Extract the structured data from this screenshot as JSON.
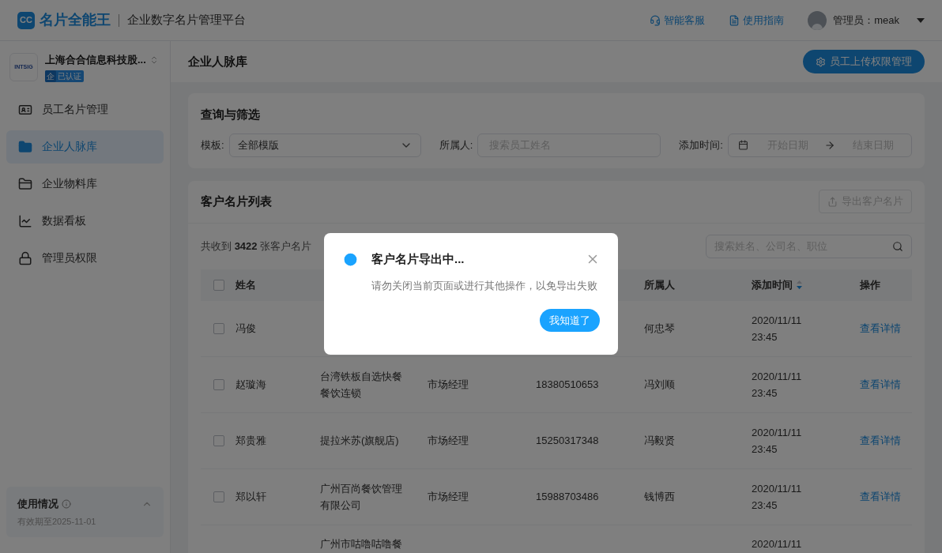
{
  "header": {
    "logo_mark": "CC",
    "brand": "名片全能王",
    "subtitle": "企业数字名片管理平台",
    "links": [
      {
        "label": "智能客服",
        "kind": "support"
      },
      {
        "label": "使用指南",
        "kind": "guide"
      }
    ],
    "user": "管理员：meak"
  },
  "company": {
    "logo_text": "INTSIG",
    "name": "上海合合信息科技股...",
    "badge_mark": "企",
    "badge": "已认证"
  },
  "sidebar": {
    "items": [
      {
        "label": "员工名片管理",
        "kind": "card",
        "selected": false
      },
      {
        "label": "企业人脉库",
        "kind": "contacts",
        "selected": true
      },
      {
        "label": "企业物料库",
        "kind": "folder",
        "selected": false
      },
      {
        "label": "数据看板",
        "kind": "chart",
        "selected": false
      },
      {
        "label": "管理员权限",
        "kind": "lock",
        "selected": false
      }
    ],
    "usage": {
      "title": "使用情况",
      "expiry": "有效期至2025-11-01",
      "expanded": true
    }
  },
  "page": {
    "title": "企业人脉库",
    "action": "员工上传权限管理"
  },
  "filter": {
    "title": "查询与筛选",
    "template_label": "模板:",
    "template_value": "全部模版",
    "owner_label": "所属人:",
    "owner_placeholder": "搜索员工姓名",
    "date_label": "添加时间:",
    "start_placeholder": "开始日期",
    "end_placeholder": "结束日期"
  },
  "list": {
    "title": "客户名片列表",
    "export": "导出客户名片",
    "export_disabled": true,
    "count_prefix": "共收到 ",
    "count": "3422",
    "count_suffix": " 张客户名片",
    "search_placeholder": "搜索姓名、公司名、职位",
    "header": {
      "checked": false,
      "name": "姓名",
      "owner": "所属人",
      "added": "添加时间",
      "added_sort_descending": true,
      "action": "操作"
    },
    "rows": [
      {
        "checked": false,
        "name": "冯俊",
        "owner": "何忠琴",
        "date": "2020/11/11",
        "time": "23:45",
        "action": "查看详情"
      },
      {
        "checked": false,
        "name": "赵璇海",
        "company": "台湾铁板自选快餐餐饮连锁",
        "position": "市场经理",
        "phone": "18380510653",
        "owner": "冯刘顺",
        "date": "2020/11/11",
        "time": "23:45",
        "action": "查看详情"
      },
      {
        "checked": false,
        "name": "郑贵雅",
        "company": "提拉米苏(旗舰店)",
        "position": "市场经理",
        "phone": "15250317348",
        "owner": "冯毅贤",
        "date": "2020/11/11",
        "time": "23:45",
        "action": "查看详情"
      },
      {
        "checked": false,
        "name": "郑以轩",
        "company": "广州百尚餐饮管理有限公司",
        "position": "市场经理",
        "phone": "15988703486",
        "owner": "钱博西",
        "date": "2020/11/11",
        "time": "23:45",
        "action": "查看详情"
      },
      {
        "company": "广州市咕噜咕噜餐",
        "date": "2020/11/11"
      }
    ]
  },
  "dialog": {
    "open": true,
    "title": "客户名片导出中...",
    "message": "请勿关闭当前页面或进行其他操作，以免导出失败",
    "confirm": "我知道了"
  }
}
